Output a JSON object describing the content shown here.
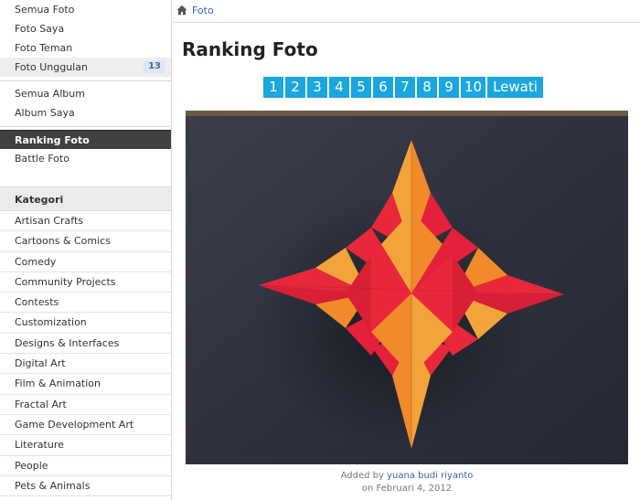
{
  "sidebar": {
    "photos": [
      {
        "label": "Semua Foto"
      },
      {
        "label": "Foto Saya"
      },
      {
        "label": "Foto Teman"
      },
      {
        "label": "Foto Unggulan",
        "badge": "13"
      }
    ],
    "albums": [
      {
        "label": "Semua Album"
      },
      {
        "label": "Album Saya"
      }
    ],
    "ranking": [
      {
        "label": "Ranking Foto"
      },
      {
        "label": "Battle Foto"
      }
    ],
    "category_title": "Kategori",
    "categories": [
      "Artisan Crafts",
      "Cartoons & Comics",
      "Comedy",
      "Community Projects",
      "Contests",
      "Customization",
      "Designs & Interfaces",
      "Digital Art",
      "Film & Animation",
      "Fractal Art",
      "Game Development Art",
      "Literature",
      "People",
      "Pets & Animals"
    ]
  },
  "breadcrumb": {
    "label": "Foto"
  },
  "main": {
    "title": "Ranking Foto",
    "pages": [
      "1",
      "2",
      "3",
      "4",
      "5",
      "6",
      "7",
      "8",
      "9",
      "10"
    ],
    "next_label": "Lewati",
    "caption": {
      "prefix": "Added by",
      "user": "yuana budi riyanto",
      "date": "on Februari 4, 2012"
    }
  },
  "colors": {
    "pager": "#1aa7e0",
    "link": "#3b65a8",
    "active_nav": "#404040"
  }
}
